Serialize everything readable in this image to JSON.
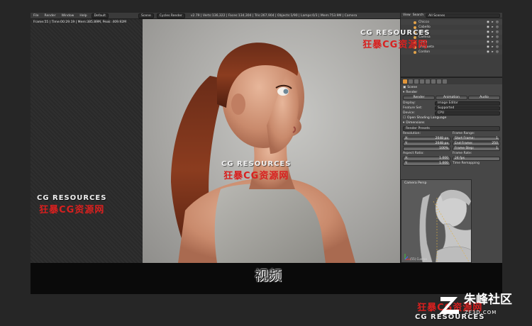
{
  "blender": {
    "menus": [
      "File",
      "Render",
      "Window",
      "Help"
    ],
    "layout": "Default",
    "scene": "Scene",
    "engine": "Cycles Render",
    "stats": "v2.79 | Verts:136,322 | Faces:134,304 | Tris:267,904 | Objects:1/90 | Lamps:0/3 | Mem:753.9M | Camera",
    "frame_info": "Frame:55 | Time:00:29.19 | Mem:385.89M, Peak: 409.92M"
  },
  "outliner": {
    "view": "View",
    "search": "Search",
    "filter": "All Scenes",
    "items": [
      "Chicco",
      "Cabello",
      "Belan",
      "Camisa",
      "Calca",
      "Chaqueta",
      "Cordon"
    ]
  },
  "properties": {
    "object": "Scene",
    "render_section": "Render",
    "render_buttons": [
      "Render",
      "Animation",
      "Audio"
    ],
    "display_label": "Display:",
    "display_value": "Image Editor",
    "feature_label": "Feature Set:",
    "feature_value": "Supported",
    "device_label": "Device:",
    "device_value": "CPU",
    "osl_label": "Open Shading Language",
    "dimensions_section": "Dimensions",
    "presets": "Render Presets",
    "resolution_label": "Resolution:",
    "res_x": "2048 px",
    "res_y": "2048 px",
    "res_pct": "100%",
    "frame_range_label": "Frame Range:",
    "start_frame": "1",
    "end_frame": "250",
    "frame_step": "1",
    "aspect_label": "Aspect Ratio:",
    "aspect_x": "1.000",
    "aspect_y": "1.000",
    "frame_rate_label": "Frame Rate:",
    "frame_rate": "24 fps",
    "time_remap": "Time Remapping"
  },
  "camera_view": {
    "label": "Camera Persp",
    "object": "(55) Cuerpo"
  },
  "subtitle": "视频",
  "watermark": {
    "en": "CG RESOURCES",
    "cn": "狂暴CG资源网"
  },
  "logo": {
    "text": "朱峰社区",
    "url": "ZF3D.COM"
  }
}
